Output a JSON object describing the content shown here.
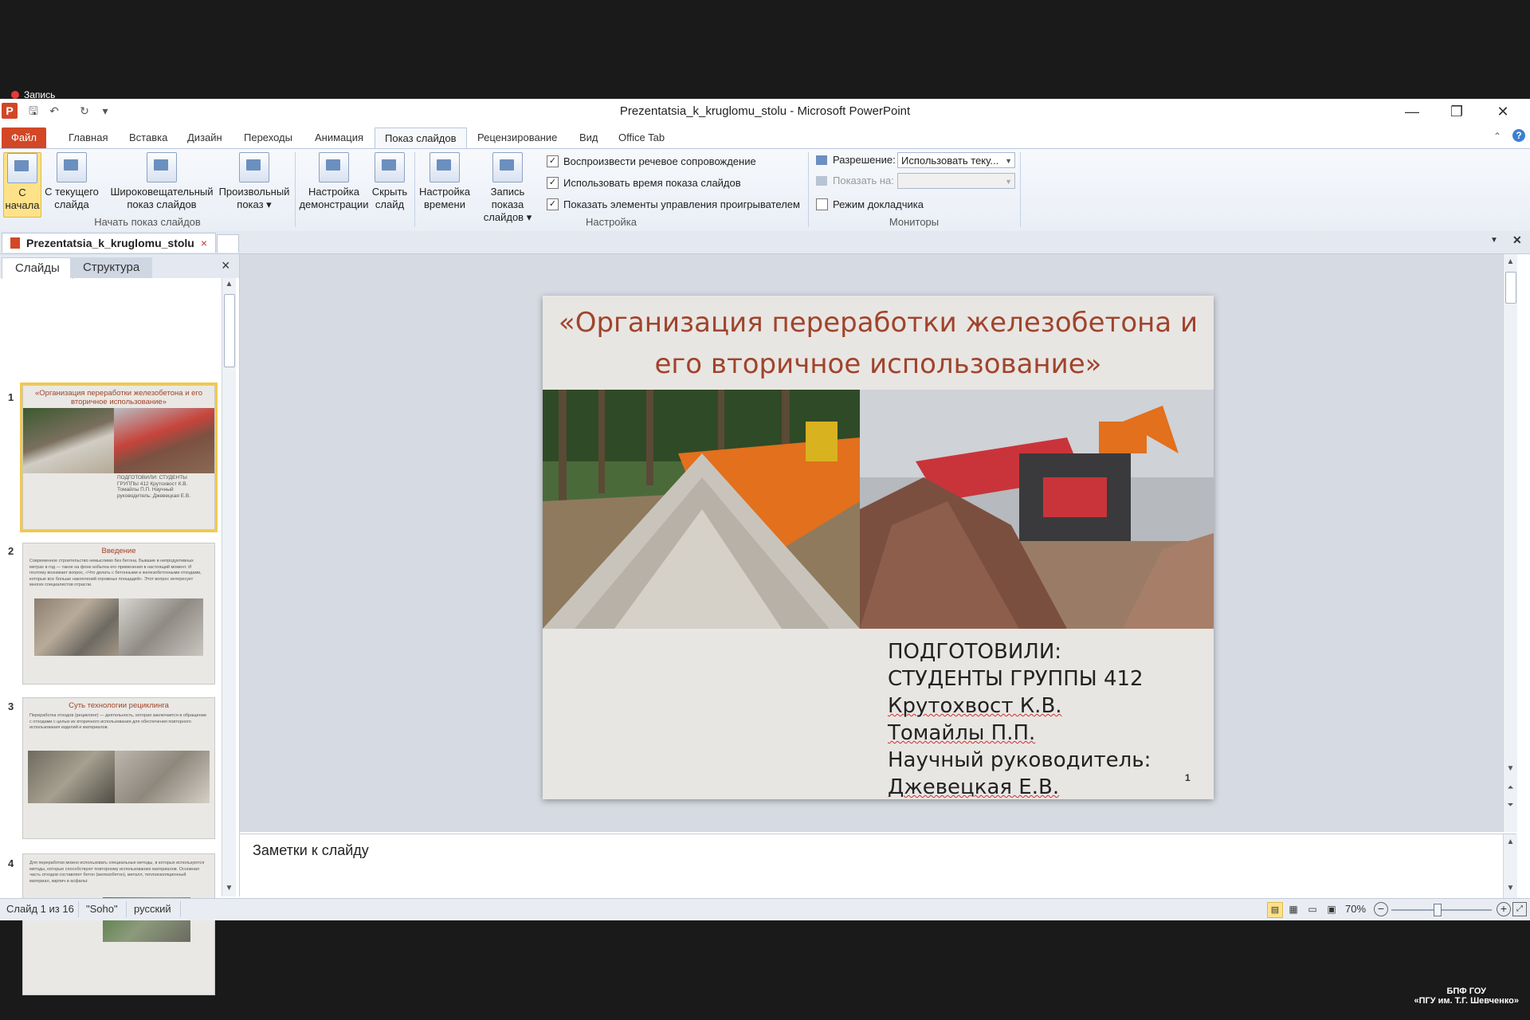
{
  "recording": {
    "label": "Запись"
  },
  "window": {
    "title": "Prezentatsia_k_kruglomu_stolu - Microsoft PowerPoint",
    "app_icon_letter": "P"
  },
  "tabs": [
    {
      "label": "Файл"
    },
    {
      "label": "Главная"
    },
    {
      "label": "Вставка"
    },
    {
      "label": "Дизайн"
    },
    {
      "label": "Переходы"
    },
    {
      "label": "Анимация"
    },
    {
      "label": "Показ слайдов"
    },
    {
      "label": "Рецензирование"
    },
    {
      "label": "Вид"
    },
    {
      "label": "Office Tab"
    }
  ],
  "ribbon": {
    "btn_from_start": "С начала",
    "btn_from_current": "С текущего слайда",
    "btn_broadcast": "Широковещательный показ слайдов",
    "btn_custom": "Произвольный показ ▾",
    "group_start": "Начать показ слайдов",
    "btn_setup": "Настройка демонстрации",
    "btn_hide": "Скрыть слайд",
    "btn_rehearse": "Настройка времени",
    "btn_record": "Запись показа слайдов ▾",
    "chk_narration": "Воспроизвести речевое сопровождение",
    "chk_timings": "Использовать время показа слайдов",
    "chk_controls": "Показать элементы управления проигрывателем",
    "group_setup": "Настройка",
    "resolution_label": "Разрешение:",
    "resolution_value": "Использовать теку...",
    "show_on_label": "Показать на:",
    "presenter_view": "Режим докладчика",
    "group_monitors": "Мониторы",
    "checkmark": "✓"
  },
  "doc_tab": {
    "name": "Prezentatsia_k_kruglomu_stolu",
    "close": "×"
  },
  "left_panel": {
    "tab_slides": "Слайды",
    "tab_outline": "Структура",
    "close": "×",
    "thumbs": [
      {
        "num": "1",
        "title": "«Организация переработки железобетона и его вторичное использование»",
        "text": "ПОДГОТОВИЛИ: СТУДЕНТЫ ГРУППЫ 412 Крутохвост К.В. Томайлы П.П. Научный руководитель: Джевецкая Е.В."
      },
      {
        "num": "2",
        "title": "Введение",
        "text": "Современное строительство немыслимо без бетона. Бывшие в непродуктивных метрах в год — такое на фоне избытка его применения в настоящий момент. И поэтому возникает вопрос, «Что делать с бетонными и железобетонными отходами, которые все больше накоплений огромных площадей». Этот вопрос интересует многих специалистов отрасли."
      },
      {
        "num": "3",
        "title": "Суть технологии рециклинга",
        "text": "Переработка отходов (рециклинг) — деятельность, которая заключается в обращении с отходами с целью их вторичного использования для обеспечения повторного использования изделий и материалов."
      },
      {
        "num": "4",
        "title": "",
        "text": "Для переработки можно использовать специальные методы, в которых используются методы, которые способствуют повторному использованию материалов. Основная часть отходов составляет бетон (железобетон), металл, теплоизоляционный материал, кирпич и асфальт."
      }
    ]
  },
  "slide": {
    "title": "«Организация переработки железобетона и его вторичное использование»",
    "authors_heading": "ПОДГОТОВИЛИ:",
    "group": "СТУДЕНТЫ ГРУППЫ 412",
    "author1": "Крутохвост К.В.",
    "author2": "Томайлы П.П.",
    "supervisor_label": "Научный руководитель:",
    "supervisor": "Джевецкая Е.В.",
    "number": "1"
  },
  "notes": {
    "placeholder": "Заметки к слайду"
  },
  "status": {
    "slide_of": "Слайд 1 из 16",
    "theme": "\"Soho\"",
    "language": "русский",
    "zoom": "70%",
    "zoom_fraction": 0.45
  },
  "watermark": {
    "line1": "БПФ ГОУ",
    "line2": "«ПГУ им. Т.Г. Шевченко»"
  }
}
